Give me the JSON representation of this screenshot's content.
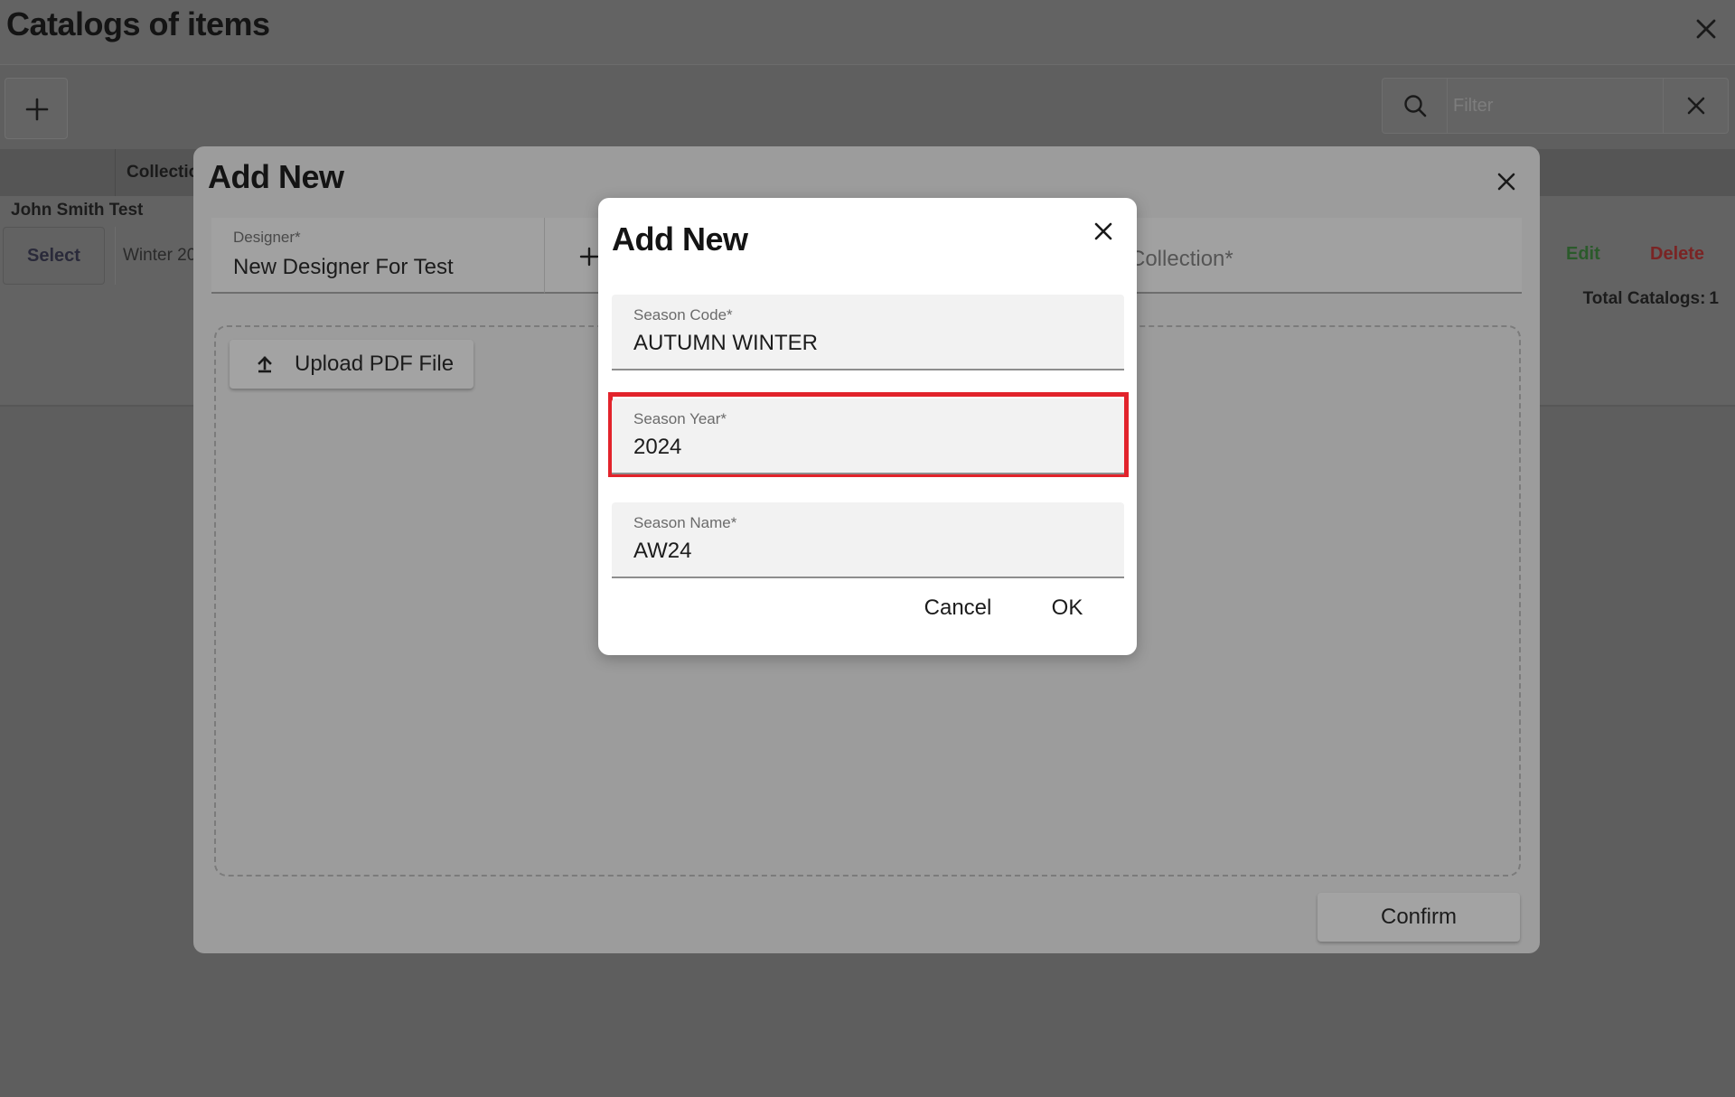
{
  "page": {
    "title": "Catalogs of items",
    "filter_placeholder": "Filter"
  },
  "table": {
    "column_header": "Collectio",
    "group_label": "John Smith Test",
    "select_label": "Select",
    "row_cell": "Winter 20",
    "edit_label": "Edit",
    "delete_label": "Delete",
    "total_label": "Total Catalogs:",
    "total_count": "1"
  },
  "outer_dialog": {
    "title": "Add New",
    "designer_label": "Designer*",
    "designer_value": "New Designer For Test",
    "collection_placeholder": "Collection*",
    "upload_label": "Upload PDF File",
    "confirm_label": "Confirm"
  },
  "inner_dialog": {
    "title": "Add New",
    "season_code_label": "Season Code*",
    "season_code_value": "AUTUMN WINTER",
    "season_year_label": "Season Year*",
    "season_year_value": "2024",
    "season_name_label": "Season Name*",
    "season_name_value": "AW24",
    "cancel_label": "Cancel",
    "ok_label": "OK"
  },
  "colors": {
    "highlight": "#e2232b",
    "edit": "#2b5a2b",
    "delete": "#7a2424"
  }
}
